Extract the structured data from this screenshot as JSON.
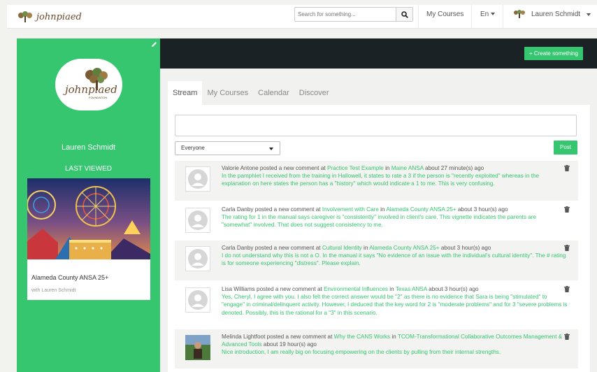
{
  "nav": {
    "brand": "johnpiaed",
    "search_placeholder": "Search for something...",
    "my_courses": "My Courses",
    "language": "En",
    "user_name": "Lauren Schmidt"
  },
  "sidebar": {
    "name": "Lauren Schmidt",
    "last_viewed_label": "LAST VIEWED",
    "course_title": "Alameda County ANSA 25+",
    "course_with": "with Lauren Schmidt"
  },
  "header": {
    "create_label": "+ Create something"
  },
  "tabs": [
    "Stream",
    "My Courses",
    "Calendar",
    "Discover"
  ],
  "composer": {
    "audience": "Everyone",
    "post_label": "Post"
  },
  "feed": [
    {
      "author": "Valorie Antone",
      "action": " posted a new comment at ",
      "target": "Practice Test Example",
      "in": " in ",
      "course": "Maine ANSA",
      "time": " about 27 minute(s) ago",
      "body": "In the pamphlet I received from the training in Hallowell, it states to rate a 3 if the person is \"recently exploited\" whereas in the explanation on here states the person has a \"history\" which would indicate a 1 to me. This is very confusing."
    },
    {
      "author": "Carla Danby",
      "action": " posted a new comment at ",
      "target": "Involvement with Care",
      "in": " in ",
      "course": "Alameda County ANSA 25+",
      "time": " about 3 hour(s) ago",
      "body": "The rating for 1 in the manual says caregiver is \"consistently\" involved in client's care. This vignette indicates the parents are \"somewhat\" involved. That does not suggest consistency to me."
    },
    {
      "author": "Carla Danby",
      "action": " posted a new comment at ",
      "target": "Cultural Identity",
      "in": " in ",
      "course": "Alameda County ANSA 25+",
      "time": " about 3 hour(s) ago",
      "body": "I do not understand why this is not a O. In the manual it says \"No evidence of an issue with the individual's cultural identity\". The # rating is for someone experiencing \"distress\". Please explain."
    },
    {
      "author": "Lisa Williams",
      "action": " posted a new comment at ",
      "target": "Environmental Influences",
      "in": " in ",
      "course": "Texas ANSA",
      "time": " about 3 hour(s) ago",
      "body": "Yes, Cheryl, I agree with you. I also felt the correct answer would be \"2\" as there is no evidence that Sara is being \"stimulated\" to \"engage\" in criminal/delinquent activity. However, I deduced that the key word for 2 is \"moderate problems\" and for 3 \"severe problems is denoted. Possibly, this is the rational for a \"3\" in this scenario."
    },
    {
      "author": "Melinda Lightfoot",
      "action": " posted a new comment at ",
      "target": "Why the CANS Works",
      "in": " in ",
      "course": "TCOM-Transformational Collaborative Outcomes Management & Advanced Tools",
      "time": " about 19 hour(s) ago",
      "body": "Nice introduction, I am really big on focusing empowering on the clients by pulling from their internal strengths."
    }
  ],
  "colors": {
    "accent": "#35c66f",
    "dark": "#1a2226"
  }
}
